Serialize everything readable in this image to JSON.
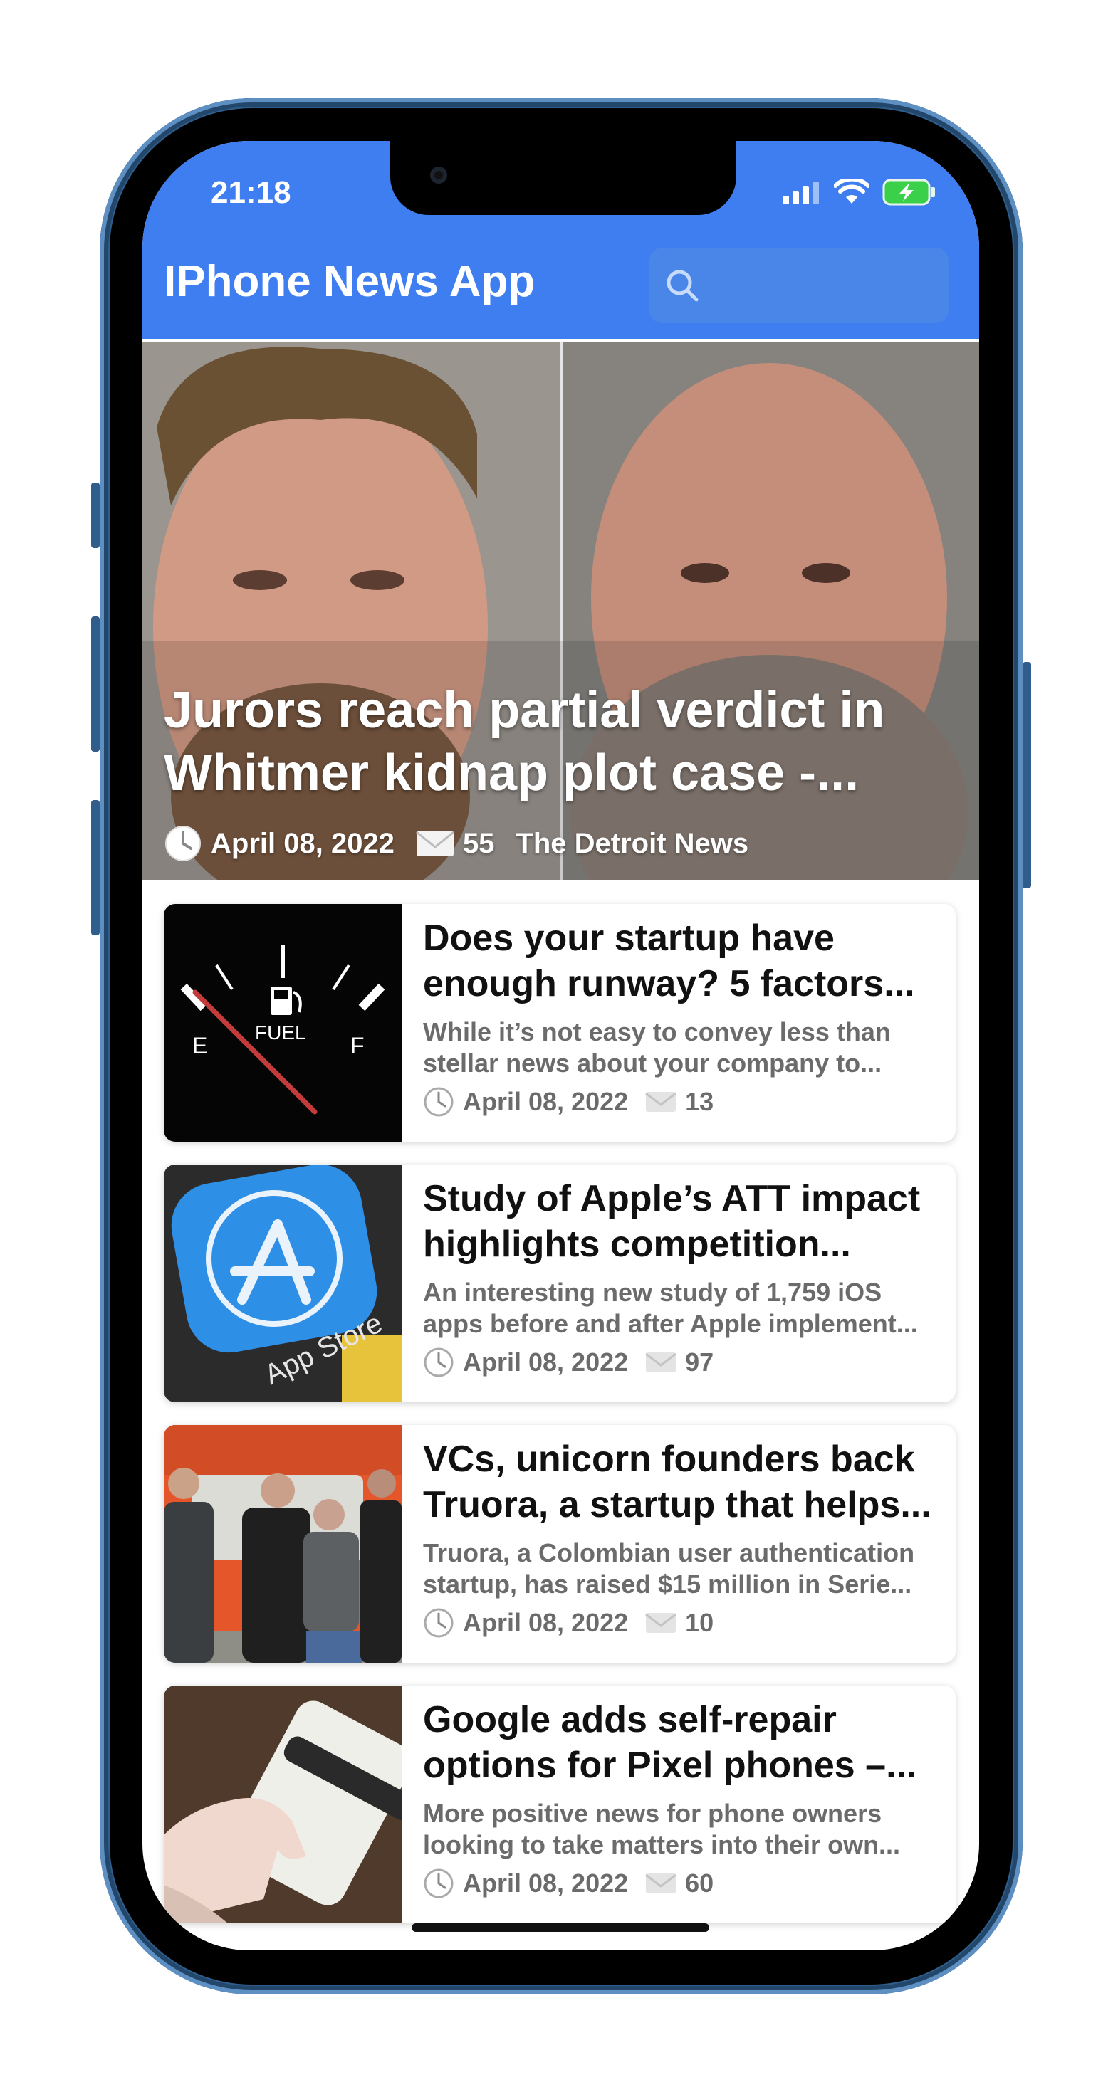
{
  "status": {
    "time": "21:18"
  },
  "app": {
    "title": "IPhone News App",
    "search_placeholder": ""
  },
  "hero": {
    "title": "Jurors reach partial verdict in Whitmer kidnap plot case -...",
    "date": "April 08, 2022",
    "comments": "55",
    "source": "The Detroit News"
  },
  "articles": [
    {
      "title": "Does your startup have enough runway? 5 factors...",
      "description": "While it’s not easy to convey less than stellar news about your company to...",
      "date": "April 08, 2022",
      "comments": "13",
      "thumb_labels": {
        "e": "E",
        "fuel": "FUEL",
        "f": "F"
      }
    },
    {
      "title": "Study of Apple’s ATT impact highlights competition...",
      "description": "An interesting new study of 1,759 iOS apps before and after Apple implement...",
      "date": "April 08, 2022",
      "comments": "97",
      "thumb_labels": {
        "app_store": "App Store"
      }
    },
    {
      "title": "VCs, unicorn founders back Truora, a startup that helps...",
      "description": "Truora, a Colombian user authentication startup, has raised $15 million in Serie...",
      "date": "April 08, 2022",
      "comments": "10"
    },
    {
      "title": "Google adds self-repair options for Pixel phones –...",
      "description": "More positive news for phone owners looking to take matters into their own...",
      "date": "April 08, 2022",
      "comments": "60"
    }
  ],
  "colors": {
    "accent": "#3e7ef0",
    "frame": "#2f5d8c"
  }
}
